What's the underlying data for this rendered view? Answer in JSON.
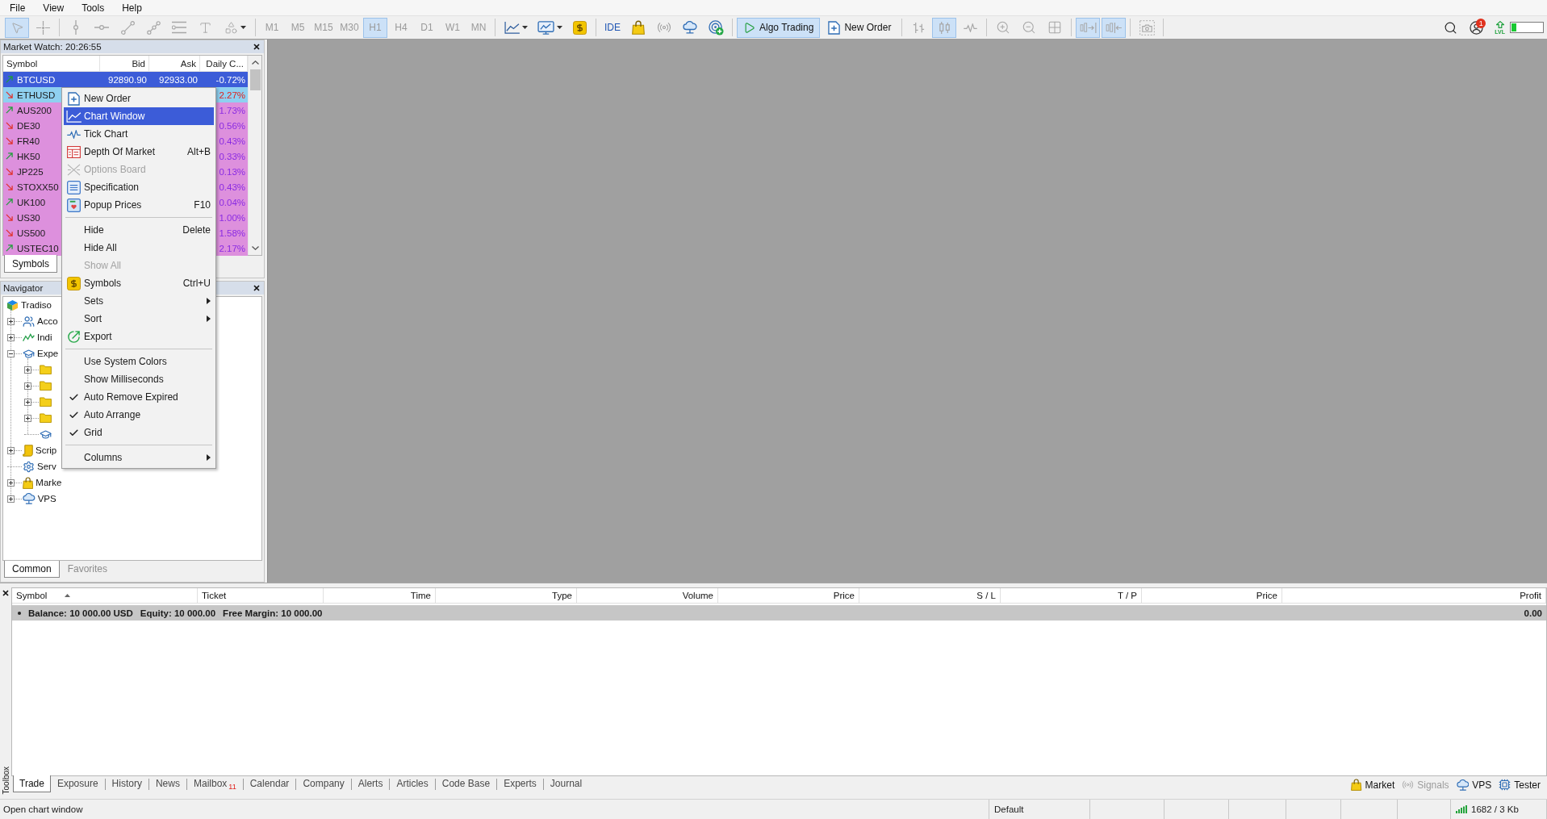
{
  "menu_bar": [
    "File",
    "View",
    "Tools",
    "Help"
  ],
  "toolbar": {
    "chart_tools_disabled": true,
    "tools": [
      {
        "selected": true
      },
      {
        "selected": false
      },
      {
        "selected": false
      },
      {
        "selected": false
      },
      {
        "selected": false
      },
      {
        "selected": false
      },
      {
        "selected": false
      },
      {
        "selected": false
      },
      {
        "selected": false
      }
    ],
    "timeframes": [
      {
        "label": "M1",
        "selected": false
      },
      {
        "label": "M5",
        "selected": false
      },
      {
        "label": "M15",
        "selected": false
      },
      {
        "label": "M30",
        "selected": false
      },
      {
        "label": "H1",
        "selected": true
      },
      {
        "label": "H4",
        "selected": false
      },
      {
        "label": "D1",
        "selected": false
      },
      {
        "label": "W1",
        "selected": false
      },
      {
        "label": "MN",
        "selected": false
      }
    ],
    "ide": "IDE",
    "algo_trading": {
      "label": "Algo Trading",
      "on": true
    },
    "new_order": "New Order",
    "chart_types": [
      {
        "selected": false
      },
      {
        "selected": true
      },
      {
        "selected": false
      }
    ],
    "auto_scroll": {
      "on": true
    },
    "chart_shift": {
      "on": true
    },
    "notifications": {
      "count": "1"
    },
    "connection_meter": {
      "label": "LVL",
      "level": 0.15
    }
  },
  "market_watch": {
    "title": "Market Watch: 20:26:55",
    "columns": [
      "Symbol",
      "Bid",
      "Ask",
      "Daily C..."
    ],
    "rows": [
      {
        "symbol": "BTCUSD",
        "rising": true,
        "bid": "92890.90",
        "ask": "92933.00",
        "change": {
          "text": "-0.72%"
        },
        "selected": true
      },
      {
        "symbol": "ETHUSD",
        "rising": false,
        "change": {
          "text": "2.27%",
          "color": "#e0201c"
        },
        "color": "#8fd0f0",
        "selected": false
      },
      {
        "symbol": "AUS200",
        "rising": true,
        "change": {
          "text": "1.73%",
          "color": "#8a2be2"
        },
        "color": "#dd90dd",
        "selected": false
      },
      {
        "symbol": "DE30",
        "rising": false,
        "change": {
          "text": "0.56%",
          "color": "#8a2be2"
        },
        "color": "#dd90dd",
        "selected": false
      },
      {
        "symbol": "FR40",
        "rising": false,
        "change": {
          "text": "0.43%",
          "color": "#8a2be2"
        },
        "color": "#dd90dd",
        "selected": false
      },
      {
        "symbol": "HK50",
        "rising": true,
        "change": {
          "text": "0.33%",
          "color": "#8a2be2"
        },
        "color": "#dd90dd",
        "selected": false
      },
      {
        "symbol": "JP225",
        "rising": false,
        "change": {
          "text": "0.13%",
          "color": "#8a2be2"
        },
        "color": "#dd90dd",
        "selected": false
      },
      {
        "symbol": "STOXX50",
        "rising": false,
        "change": {
          "text": "0.43%",
          "color": "#8a2be2"
        },
        "color": "#dd90dd",
        "selected": false
      },
      {
        "symbol": "UK100",
        "rising": true,
        "change": {
          "text": "0.04%",
          "color": "#8a2be2"
        },
        "color": "#dd90dd",
        "selected": false
      },
      {
        "symbol": "US30",
        "rising": false,
        "change": {
          "text": "1.00%",
          "color": "#8a2be2"
        },
        "color": "#dd90dd",
        "selected": false
      },
      {
        "symbol": "US500",
        "rising": false,
        "change": {
          "text": "1.58%",
          "color": "#8a2be2"
        },
        "color": "#dd90dd",
        "selected": false
      },
      {
        "symbol": "USTEC10",
        "rising": true,
        "change": {
          "text": "2.17%",
          "color": "#8a2be2"
        },
        "color": "#dd90dd",
        "selected": false
      }
    ],
    "tabs": [
      {
        "label": "Symbols",
        "selected": true
      }
    ]
  },
  "context_menu": {
    "items": [
      {
        "kind": "item",
        "label": "New Order",
        "selected": false,
        "disabled": false
      },
      {
        "kind": "item",
        "label": "Chart Window",
        "selected": true,
        "disabled": false
      },
      {
        "kind": "item",
        "label": "Tick Chart",
        "selected": false,
        "disabled": false
      },
      {
        "kind": "item",
        "label": "Depth Of Market",
        "shortcut": "Alt+B",
        "selected": false,
        "disabled": false
      },
      {
        "kind": "item",
        "label": "Options Board",
        "selected": false,
        "disabled": true
      },
      {
        "kind": "item",
        "label": "Specification",
        "selected": false,
        "disabled": false
      },
      {
        "kind": "item",
        "label": "Popup Prices",
        "shortcut": "F10",
        "selected": false,
        "disabled": false
      },
      {
        "kind": "separator"
      },
      {
        "kind": "item",
        "label": "Hide",
        "shortcut": "Delete",
        "selected": false,
        "disabled": false
      },
      {
        "kind": "item",
        "label": "Hide All",
        "selected": false,
        "disabled": false
      },
      {
        "kind": "item",
        "label": "Show All",
        "selected": false,
        "disabled": true
      },
      {
        "kind": "item",
        "label": "Symbols",
        "shortcut": "Ctrl+U",
        "selected": false,
        "disabled": false
      },
      {
        "kind": "submenu",
        "label": "Sets",
        "selected": false,
        "disabled": false
      },
      {
        "kind": "submenu",
        "label": "Sort",
        "selected": false,
        "disabled": false
      },
      {
        "kind": "item",
        "label": "Export",
        "selected": false,
        "disabled": false
      },
      {
        "kind": "separator"
      },
      {
        "kind": "check",
        "label": "Use System Colors",
        "checked": false,
        "selected": false,
        "disabled": false
      },
      {
        "kind": "check",
        "label": "Show Milliseconds",
        "checked": false,
        "selected": false,
        "disabled": false
      },
      {
        "kind": "check",
        "label": "Auto Remove Expired",
        "checked": true,
        "selected": false,
        "disabled": false
      },
      {
        "kind": "check",
        "label": "Auto Arrange",
        "checked": true,
        "selected": false,
        "disabled": false
      },
      {
        "kind": "check",
        "label": "Grid",
        "checked": true,
        "selected": false,
        "disabled": false
      },
      {
        "kind": "separator"
      },
      {
        "kind": "submenu",
        "label": "Columns",
        "selected": false,
        "disabled": false
      }
    ]
  },
  "navigator": {
    "title": "Navigator",
    "tree": [
      {
        "label": "Tradiso",
        "kind": "broker",
        "children": [
          {
            "label": "Acco",
            "kind": "accounts",
            "expanded": false
          },
          {
            "label": "Indi",
            "kind": "indicators",
            "expanded": false
          },
          {
            "label": "Expe",
            "kind": "experts",
            "expanded": true,
            "children": [
              {
                "kind": "folder",
                "expanded": false
              },
              {
                "kind": "folder",
                "expanded": false
              },
              {
                "kind": "folder",
                "expanded": false
              },
              {
                "kind": "folder",
                "expanded": false
              },
              {
                "kind": "expert"
              }
            ]
          },
          {
            "label": "Scrip",
            "kind": "scripts",
            "expanded": false
          },
          {
            "label": "Serv",
            "kind": "services"
          },
          {
            "label": "Marke",
            "kind": "market",
            "expanded": false
          },
          {
            "label": "VPS",
            "kind": "vps",
            "expanded": false
          }
        ]
      }
    ],
    "tabs": [
      {
        "label": "Common",
        "selected": true
      },
      {
        "label": "Favorites",
        "selected": false
      }
    ]
  },
  "toolbox": {
    "label": "Toolbox",
    "columns": [
      {
        "label": "Symbol",
        "sorted": true
      },
      {
        "label": "Ticket",
        "sorted": false
      },
      {
        "label": "Time",
        "sorted": false
      },
      {
        "label": "Type",
        "sorted": false
      },
      {
        "label": "Volume",
        "sorted": false
      },
      {
        "label": "Price",
        "sorted": false
      },
      {
        "label": "S / L",
        "sorted": false
      },
      {
        "label": "T / P",
        "sorted": false
      },
      {
        "label": "Price",
        "sorted": false
      },
      {
        "label": "Profit",
        "sorted": false
      }
    ],
    "summary": {
      "balance": "Balance: 10 000.00 USD",
      "equity": "Equity: 10 000.00",
      "free_margin": "Free Margin: 10 000.00",
      "profit": "0.00"
    },
    "tabs": [
      {
        "label": "Trade",
        "selected": true
      },
      {
        "label": "Exposure",
        "selected": false
      },
      {
        "label": "History",
        "selected": false
      },
      {
        "label": "News",
        "selected": false
      },
      {
        "label": "Mailbox",
        "selected": false,
        "count": "11"
      },
      {
        "label": "Calendar",
        "selected": false
      },
      {
        "label": "Company",
        "selected": false
      },
      {
        "label": "Alerts",
        "selected": false
      },
      {
        "label": "Articles",
        "selected": false
      },
      {
        "label": "Code Base",
        "selected": false
      },
      {
        "label": "Experts",
        "selected": false
      },
      {
        "label": "Journal",
        "selected": false
      }
    ],
    "links": [
      {
        "label": "Market",
        "disabled": false
      },
      {
        "label": "Signals",
        "disabled": true
      },
      {
        "label": "VPS",
        "disabled": false
      },
      {
        "label": "Tester",
        "disabled": false
      }
    ]
  },
  "status_bar": {
    "message": "Open chart window",
    "profile": "Default",
    "traffic": "1682 / 3 Kb"
  }
}
